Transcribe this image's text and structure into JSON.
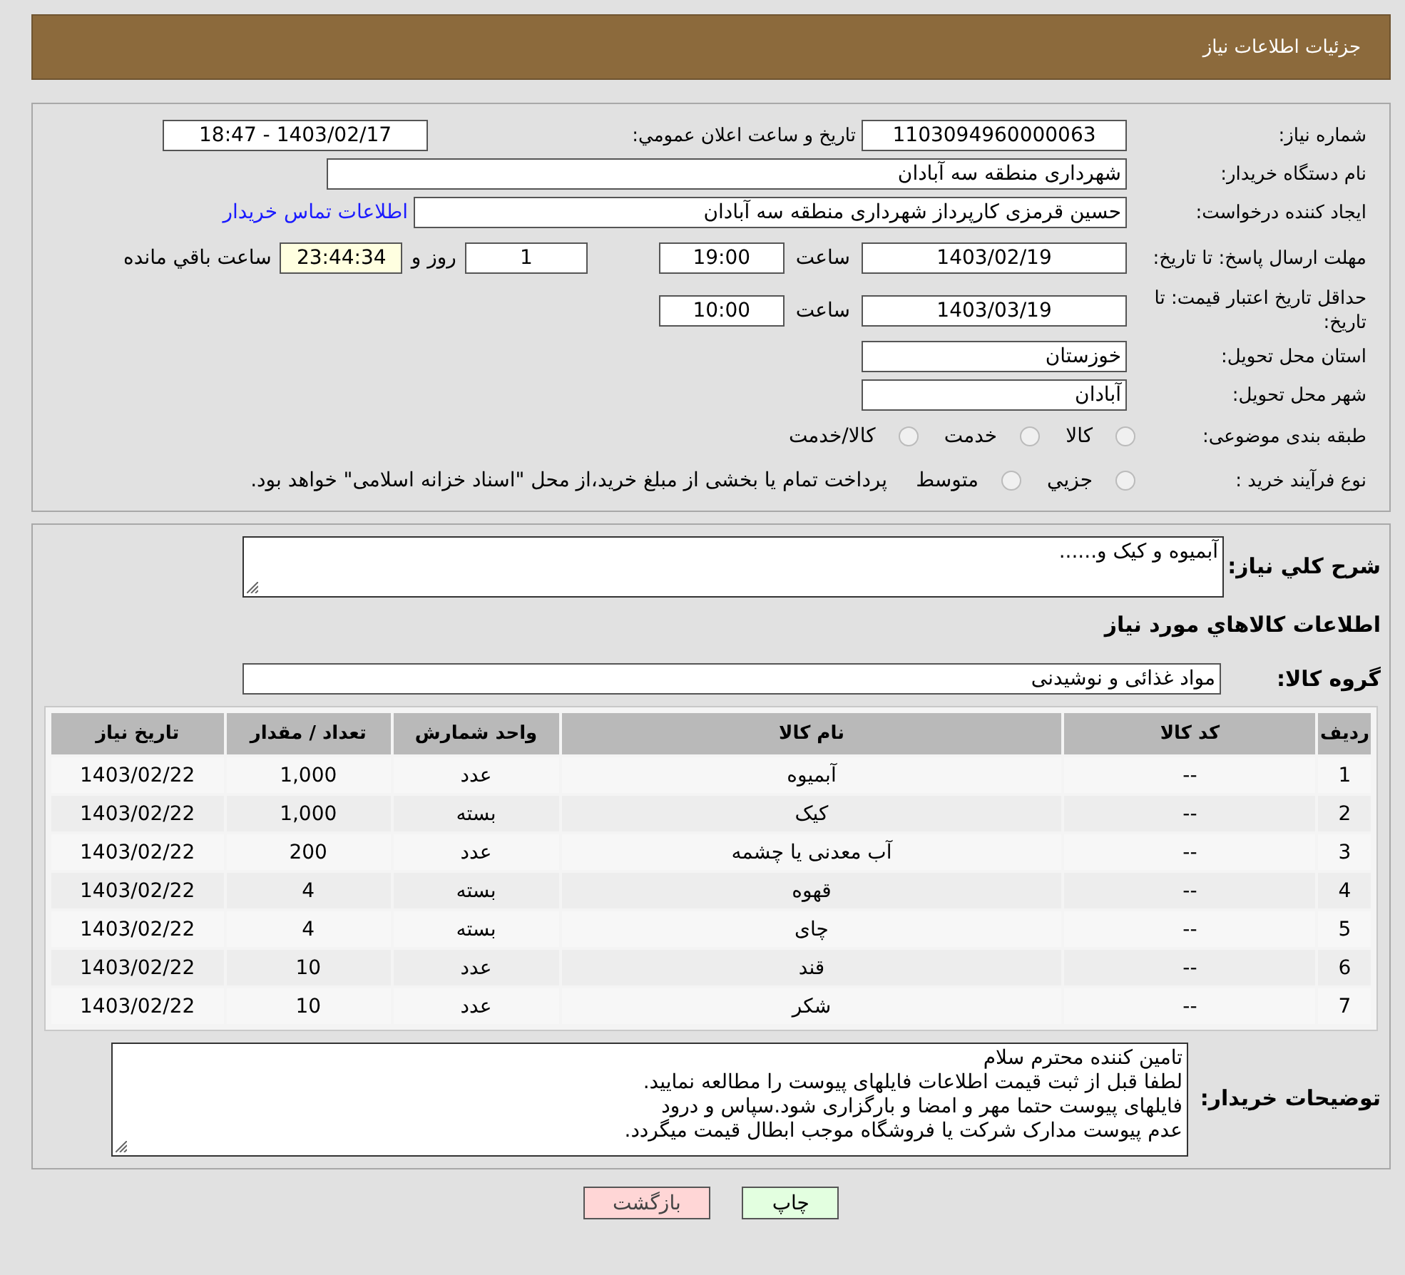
{
  "header": {
    "title": "جزئیات اطلاعات نیاز"
  },
  "details": {
    "need_number": {
      "label": "شماره نیاز:",
      "value": "1103094960000063"
    },
    "announce": {
      "label": "تاریخ و ساعت اعلان عمومي:",
      "value": "1403/02/17 - 18:47"
    },
    "buyer": {
      "label": "نام دستگاه خریدار:",
      "value": "شهرداری منطقه سه آبادان"
    },
    "requester": {
      "label": "ایجاد کننده درخواست:",
      "value": "حسین قرمزی کارپرداز شهرداری منطقه سه آبادان",
      "link": "اطلاعات تماس خریدار"
    },
    "deadline": {
      "label": "مهلت ارسال پاسخ: تا تاریخ:",
      "date": "1403/02/19",
      "time_label": "ساعت",
      "time": "19:00",
      "days": "1",
      "days_label": "روز و",
      "remaining": "23:44:34",
      "remaining_label": "ساعت باقي مانده"
    },
    "validity": {
      "label": "حداقل تاریخ اعتبار قیمت: تا تاریخ:",
      "date": "1403/03/19",
      "time_label": "ساعت",
      "time": "10:00"
    },
    "province": {
      "label": "استان محل تحویل:",
      "value": "خوزستان"
    },
    "city": {
      "label": "شهر محل تحویل:",
      "value": "آبادان"
    },
    "category": {
      "label": "طبقه بندی موضوعی:",
      "options": [
        {
          "label": "کالا",
          "selected": false
        },
        {
          "label": "خدمت",
          "selected": false
        },
        {
          "label": "کالا/خدمت",
          "selected": false
        }
      ]
    },
    "process": {
      "label": "نوع فرآیند خرید :",
      "options": [
        {
          "label": "جزيي",
          "selected": false
        },
        {
          "label": "متوسط",
          "selected": false
        }
      ],
      "note": "پرداخت تمام یا بخشی از مبلغ خرید،از محل \"اسناد خزانه اسلامی\" خواهد بود."
    }
  },
  "description": {
    "label": "شرح كلي نياز:",
    "value": "آبمیوه و کیک و......"
  },
  "goods_heading": "اطلاعات کالاهاي مورد نياز",
  "goods_group": {
    "label": "گروه کالا:",
    "value": "مواد غذائی و نوشیدنی"
  },
  "table": {
    "columns": [
      "رديف",
      "کد کالا",
      "نام کالا",
      "واحد شمارش",
      "تعداد / مقدار",
      "تاریخ نیاز"
    ],
    "rows": [
      [
        "1",
        "--",
        "آبمیوه",
        "عدد",
        "1,000",
        "1403/02/22"
      ],
      [
        "2",
        "--",
        "کیک",
        "بسته",
        "1,000",
        "1403/02/22"
      ],
      [
        "3",
        "--",
        "آب معدنی یا چشمه",
        "عدد",
        "200",
        "1403/02/22"
      ],
      [
        "4",
        "--",
        "قهوه",
        "بسته",
        "4",
        "1403/02/22"
      ],
      [
        "5",
        "--",
        "چای",
        "بسته",
        "4",
        "1403/02/22"
      ],
      [
        "6",
        "--",
        "قند",
        "عدد",
        "10",
        "1403/02/22"
      ],
      [
        "7",
        "--",
        "شکر",
        "عدد",
        "10",
        "1403/02/22"
      ]
    ]
  },
  "buyer_notes": {
    "label": "توضیحات خریدار:",
    "lines": [
      "تامین کننده محترم سلام",
      "لطفا قبل از ثبت قیمت اطلاعات فایلهای پیوست را مطالعه نمایید.",
      "فایلهای پیوست حتما مهر و امضا و بارگزاری شود.سپاس و درود",
      "عدم پیوست مدارک شرکت یا فروشگاه موجب ابطال قیمت میگردد."
    ]
  },
  "buttons": [
    {
      "kind": "print",
      "label": "چاپ"
    },
    {
      "kind": "back",
      "label": "بازگشت"
    }
  ]
}
